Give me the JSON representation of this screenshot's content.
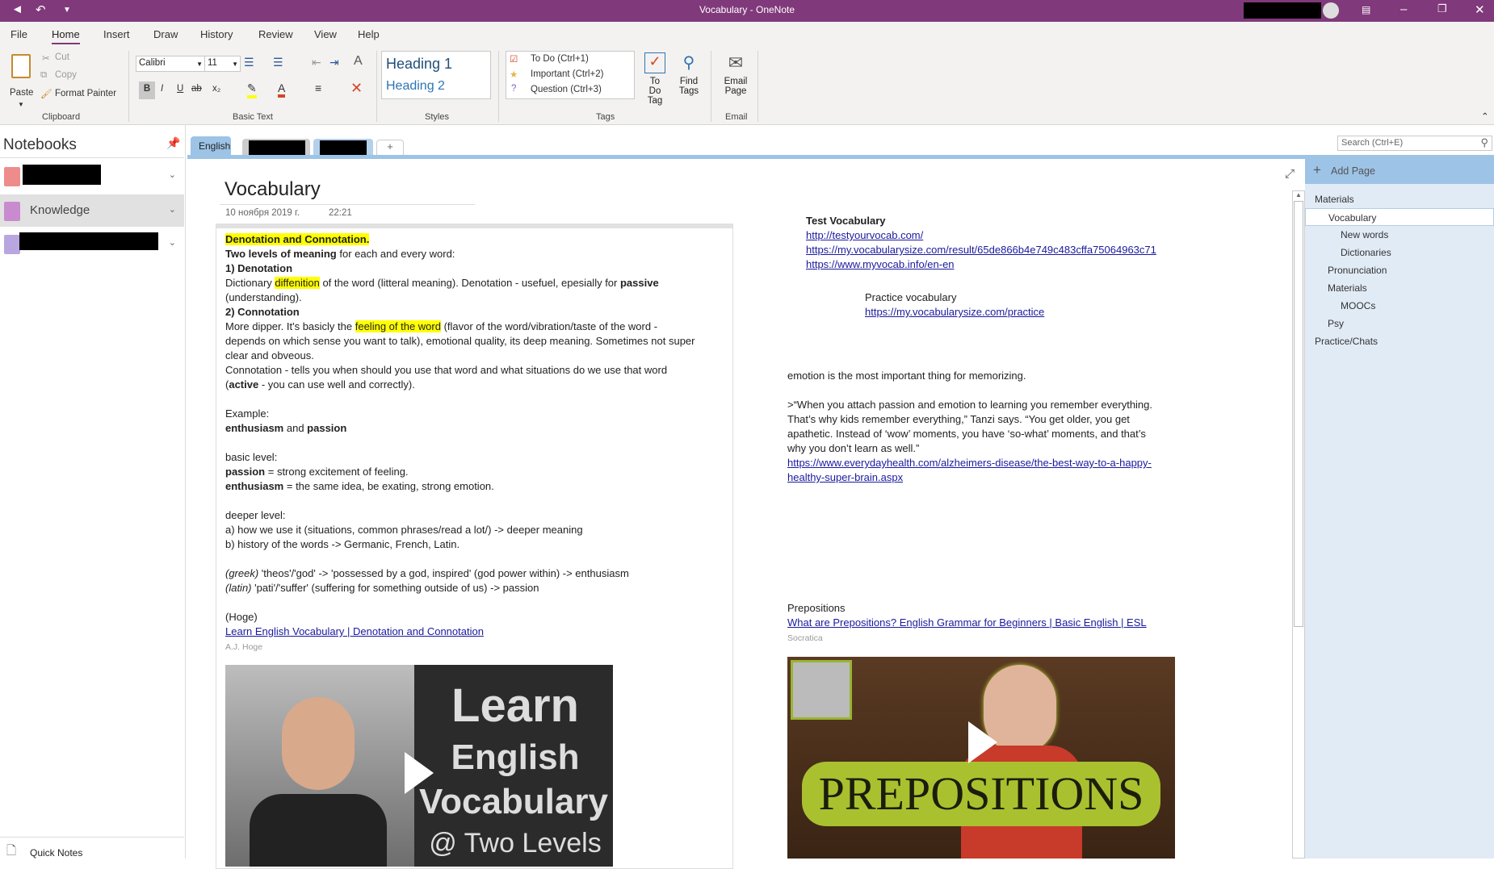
{
  "window": {
    "title": "Vocabulary  -  OneNote"
  },
  "ribbon_tabs": [
    "File",
    "Home",
    "Insert",
    "Draw",
    "History",
    "Review",
    "View",
    "Help"
  ],
  "clipboard": {
    "paste": "Paste",
    "cut": "Cut",
    "copy": "Copy",
    "format_painter": "Format Painter",
    "label": "Clipboard"
  },
  "basic_text": {
    "font": "Calibri",
    "size": "11",
    "label": "Basic Text",
    "bold": "B",
    "italic": "I",
    "underline": "U",
    "strike": "ab",
    "sub": "x₂"
  },
  "styles": {
    "h1": "Heading 1",
    "h2": "Heading 2",
    "label": "Styles"
  },
  "tags": {
    "todo": "To Do (Ctrl+1)",
    "important": "Important (Ctrl+2)",
    "question": "Question (Ctrl+3)",
    "todo_tag": [
      "To Do",
      "Tag"
    ],
    "find_tags": [
      "Find",
      "Tags"
    ],
    "label": "Tags"
  },
  "email": {
    "btn": [
      "Email",
      "Page"
    ],
    "label": "Email"
  },
  "notebooks": {
    "title": "Notebooks",
    "items": [
      {
        "label": "",
        "color": "#ee8c8c"
      },
      {
        "label": "Knowledge",
        "color": "#c98bd0"
      },
      {
        "label": "",
        "color": "#b9a6e0"
      }
    ],
    "quick_notes": "Quick Notes"
  },
  "sections": {
    "tabs": [
      "English"
    ],
    "add": "+"
  },
  "search": {
    "placeholder": "Search (Ctrl+E)"
  },
  "page": {
    "title": "Vocabulary",
    "date": "10 ноября 2019 г.",
    "time": "22:21"
  },
  "left_outline": [
    [
      {
        "t": "Denotation and Connotation.",
        "b": 1,
        "hl": 1
      }
    ],
    [
      {
        "t": "Two levels of meaning",
        "b": 1
      },
      {
        "t": " for each and every word:"
      }
    ],
    [
      {
        "t": "1) Denotation",
        "b": 1
      }
    ],
    [
      {
        "t": "Dictionary "
      },
      {
        "t": "diffenition",
        "hl": 1
      },
      {
        "t": " of the word (litteral meaning). Denotation - usefuel, epesially for "
      },
      {
        "t": "passive",
        "b": 1
      }
    ],
    [
      {
        "t": "(understanding)."
      }
    ],
    [
      {
        "t": "2) Connotation",
        "b": 1
      }
    ],
    [
      {
        "t": "More dipper. It's basicly the "
      },
      {
        "t": "feeling of the word",
        "hl": 1
      },
      {
        "t": " (flavor of the word/vibration/taste of the word -"
      }
    ],
    [
      {
        "t": "depends on which sense you want to talk), emotional quality, its deep meaning. Sometimes not super"
      }
    ],
    [
      {
        "t": "clear and obveous."
      }
    ],
    [
      {
        "t": "Connotation - tells you when should you use that word and what situations do we use that word"
      }
    ],
    [
      {
        "t": "("
      },
      {
        "t": "active",
        "b": 1
      },
      {
        "t": " - you can use well and correctly)."
      }
    ],
    [],
    [
      {
        "t": "Example:"
      }
    ],
    [
      {
        "t": "enthusiasm",
        "b": 1
      },
      {
        "t": " and "
      },
      {
        "t": "passion",
        "b": 1
      }
    ],
    [],
    [
      {
        "t": "basic level:"
      }
    ],
    [
      {
        "t": "passion",
        "b": 1
      },
      {
        "t": " = strong excitement of feeling."
      }
    ],
    [
      {
        "t": "enthusiasm",
        "b": 1
      },
      {
        "t": " = the same idea, be exating, strong emotion."
      }
    ],
    [],
    [
      {
        "t": "deeper level:"
      }
    ],
    [
      {
        "t": "a) how we use it (situations, common phrases/read a lot/) -> deeper meaning"
      }
    ],
    [
      {
        "t": "b) history of the words -> Germanic, French, Latin."
      }
    ],
    [],
    [
      {
        "t": "(greek)",
        "i": 1
      },
      {
        "t": " 'theos'/'god' -> 'possessed by a god, inspired' (god power within) -> enthusiasm"
      }
    ],
    [
      {
        "t": "(latin)",
        "i": 1
      },
      {
        "t": " 'pati'/'suffer' (suffering for something outside of us) -> passion"
      }
    ],
    [],
    [
      {
        "t": "(Hoge)"
      }
    ],
    [
      {
        "t": "Learn English Vocabulary | Denotation and Connotation",
        "link": 1
      }
    ],
    [
      {
        "t": "A.J. Hoge",
        "g": 1
      }
    ]
  ],
  "video_left": {
    "lines": [
      "Learn",
      "English",
      "Vocabulary",
      "@ Two Levels"
    ]
  },
  "right_top": [
    [
      {
        "t": "Test Vocabulary",
        "b": 1
      }
    ],
    [
      {
        "t": "http://testyourvocab.com/",
        "link": 1
      }
    ],
    [
      {
        "t": "https://my.vocabularysize.com/result/65de866b4e749c483cffa75064963c71",
        "link": 1
      }
    ],
    [
      {
        "t": "https://www.myvocab.info/en-en",
        "link": 1
      }
    ]
  ],
  "practice": [
    [
      {
        "t": "Practice vocabulary"
      }
    ],
    [
      {
        "t": "https://my.vocabularysize.com/practice",
        "link": 1
      }
    ]
  ],
  "emotion": [
    [
      {
        "t": "emotion is the most important thing for memorizing."
      }
    ],
    [],
    [
      {
        "t": ">“When you attach passion and emotion to learning you remember everything."
      }
    ],
    [
      {
        "t": "That’s why kids remember everything,” Tanzi says. “You get older, you get"
      }
    ],
    [
      {
        "t": "apathetic. Instead of ‘wow’ moments, you have ‘so-what’ moments, and that’s"
      }
    ],
    [
      {
        "t": "why you don’t learn as well.”"
      }
    ],
    [
      {
        "t": "https://www.everydayhealth.com/alzheimers-disease/the-best-way-to-a-happy-",
        "link": 1
      }
    ],
    [
      {
        "t": "healthy-super-brain.aspx",
        "link": 1
      }
    ]
  ],
  "prepositions": [
    [
      {
        "t": "Prepositions"
      }
    ],
    [
      {
        "t": "What are Prepositions? English Grammar for Beginners | Basic English | ESL",
        "link": 1
      }
    ],
    [
      {
        "t": "Socratica",
        "g": 1
      }
    ]
  ],
  "video_right": {
    "text": "PREPOSITIONS"
  },
  "page_list": {
    "add": "Add Page",
    "items": [
      {
        "label": "Materials",
        "level": 0
      },
      {
        "label": "Vocabulary",
        "level": 1,
        "selected": true
      },
      {
        "label": "New words",
        "level": 2
      },
      {
        "label": "Dictionaries",
        "level": 2
      },
      {
        "label": "Pronunciation",
        "level": 1
      },
      {
        "label": "Materials",
        "level": 1
      },
      {
        "label": "MOOCs",
        "level": 2
      },
      {
        "label": "Psy",
        "level": 1
      },
      {
        "label": "Practice/Chats",
        "level": 0
      }
    ]
  },
  "colors": {
    "brand": "#80397b",
    "section": "#9dc3e6",
    "highlight": "#ffff00",
    "link": "#1a1a9e"
  }
}
